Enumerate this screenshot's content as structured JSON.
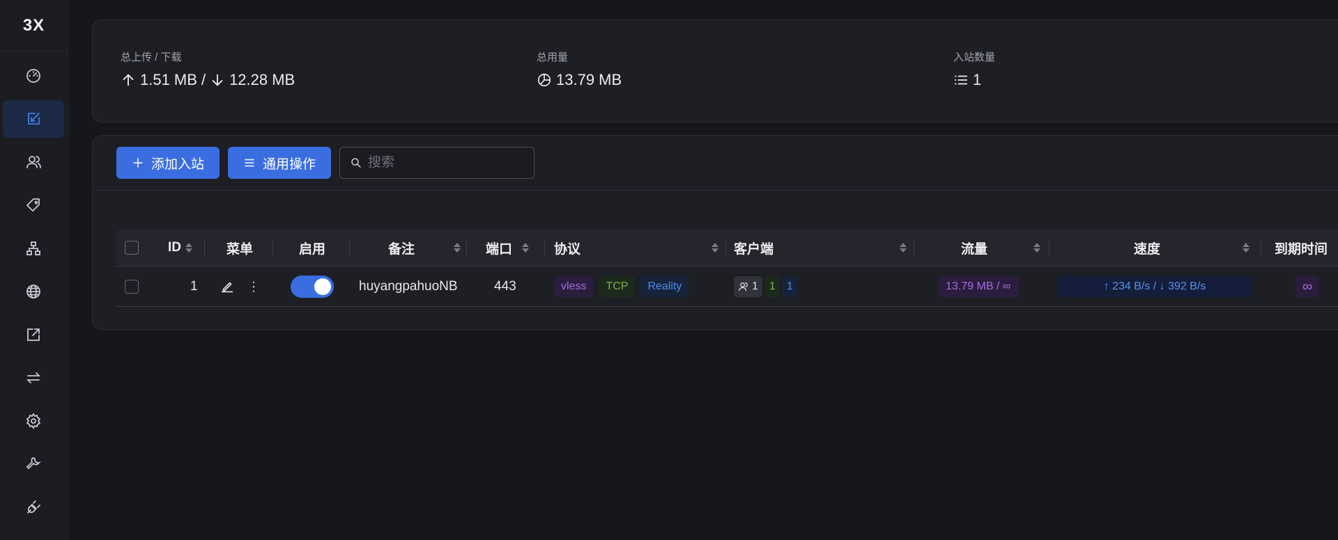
{
  "brand": "3X",
  "sidebar": {
    "items": [
      {
        "icon": "dashboard-icon"
      },
      {
        "icon": "inbounds-icon",
        "active": true
      },
      {
        "icon": "users-icon"
      },
      {
        "icon": "tag-icon"
      },
      {
        "icon": "network-icon"
      },
      {
        "icon": "globe-icon"
      },
      {
        "icon": "external-link-icon"
      },
      {
        "icon": "swap-icon"
      },
      {
        "icon": "gear-icon"
      },
      {
        "icon": "wrench-icon"
      },
      {
        "icon": "plug-icon"
      }
    ]
  },
  "stats": {
    "traffic_label": "总上传 / 下载",
    "upload": "1.51 MB",
    "separator": "/",
    "download": "12.28 MB",
    "usage_label": "总用量",
    "usage": "13.79 MB",
    "inbound_count_label": "入站数量",
    "inbound_count": "1"
  },
  "toolbar": {
    "add_label": "添加入站",
    "general_label": "通用操作",
    "search_placeholder": "搜索"
  },
  "table": {
    "headers": {
      "id": "ID",
      "menu": "菜单",
      "enable": "启用",
      "remark": "备注",
      "port": "端口",
      "protocol": "协议",
      "clients": "客户端",
      "traffic": "流量",
      "speed": "速度",
      "expiry": "到期时间"
    },
    "rows": [
      {
        "id": "1",
        "enabled": true,
        "remark": "huyangpahuoNB",
        "port": "443",
        "protocol": "vless",
        "network": "TCP",
        "security": "Reality",
        "clients_total": "1",
        "clients_online": "1",
        "clients_active": "1",
        "traffic": "13.79 MB / ∞",
        "speed": "↑ 234 B/s / ↓ 392 B/s",
        "expiry": "∞"
      }
    ]
  },
  "colors": {
    "accent": "#3a6ee0",
    "background": "#16171c",
    "card": "#1e1f25",
    "purple": "#a86ce0",
    "green": "#7bb153",
    "blue": "#4f8ef0"
  }
}
